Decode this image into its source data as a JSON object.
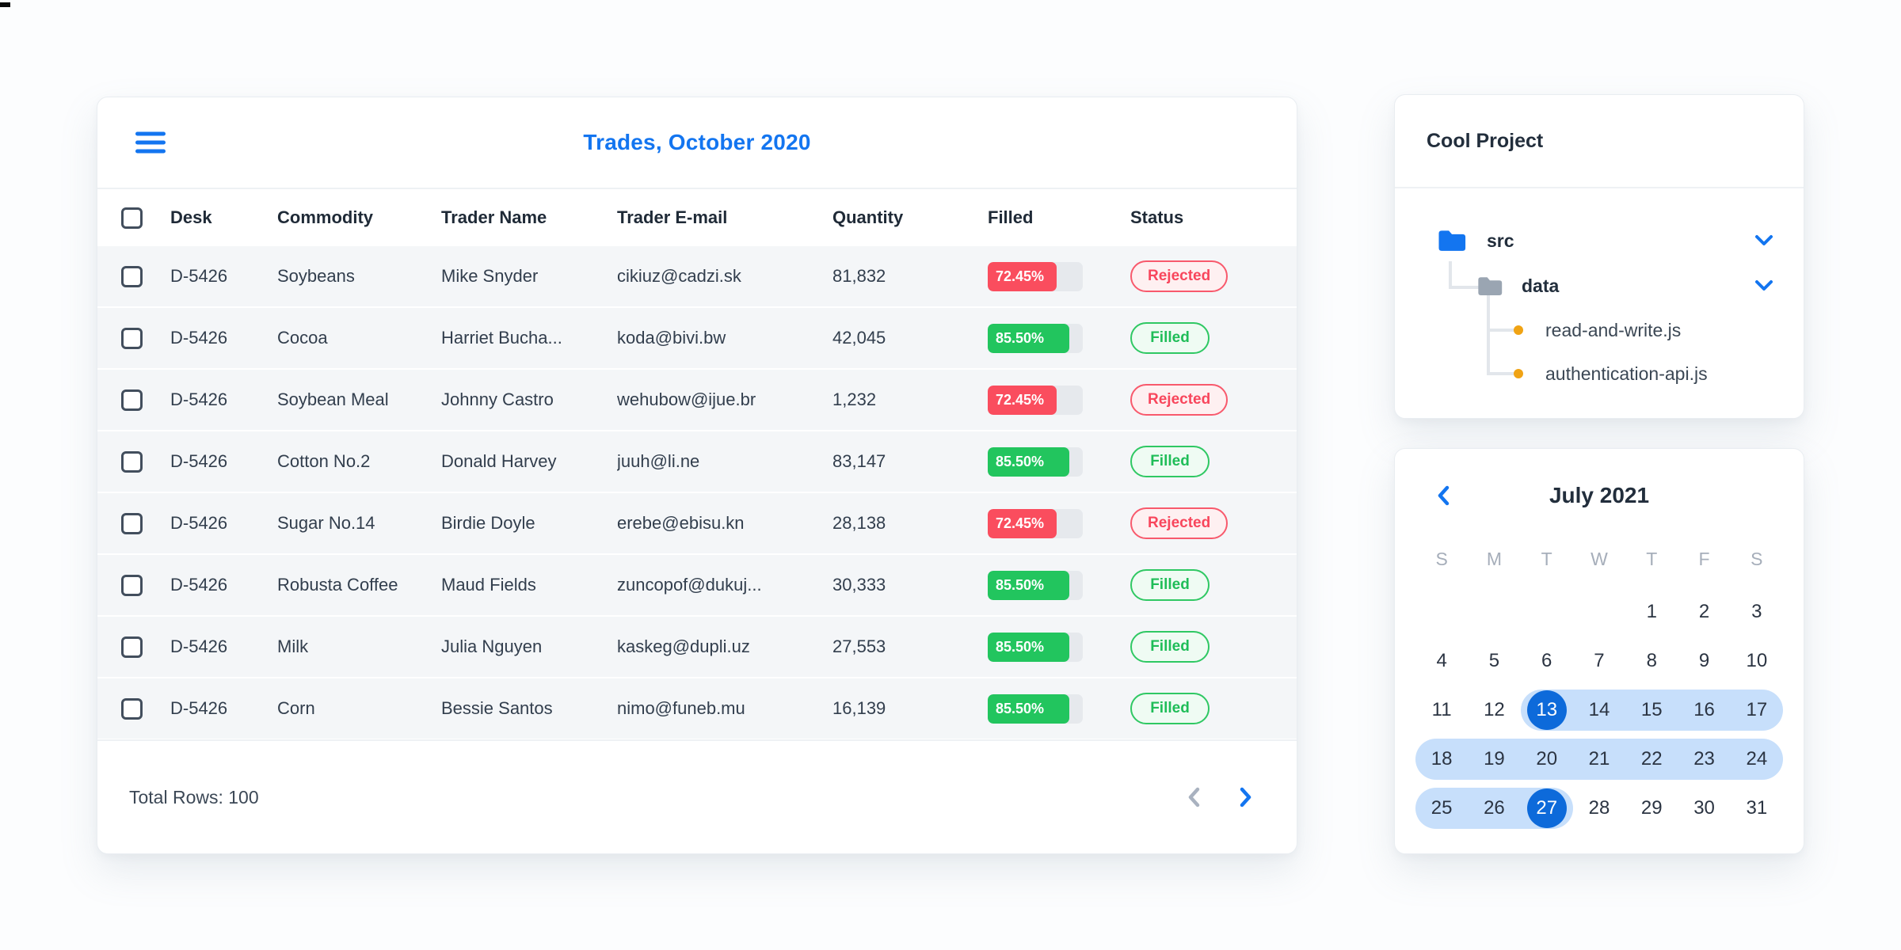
{
  "colors": {
    "accent_blue": "#1375f0",
    "calendar_selected_blue": "#0d6ada",
    "range_blue": "#c7dffb",
    "bar_red": "#fa4d5e",
    "bar_green": "#22c55e",
    "status_rejected_red": "#f8465c",
    "status_filled_green": "#1fbd58",
    "row_background": "#f4f6f8",
    "orange_dot": "#f0a314"
  },
  "trades": {
    "title": "Trades, October 2020",
    "menu_icon": "hamburger-menu",
    "columns": [
      "Desk",
      "Commodity",
      "Trader Name",
      "Trader E-mail",
      "Quantity",
      "Filled",
      "Status"
    ],
    "rows": [
      {
        "desk": "D-5426",
        "commodity": "Soybeans",
        "trader": "Mike Snyder",
        "email": "cikiuz@cadzi.sk",
        "quantity": "81,832",
        "filled_label": "72.45%",
        "filled_value": 72.45,
        "filled_color": "red",
        "status": "Rejected",
        "status_kind": "rejected"
      },
      {
        "desk": "D-5426",
        "commodity": "Cocoa",
        "trader": "Harriet Bucha...",
        "email": "koda@bivi.bw",
        "quantity": "42,045",
        "filled_label": "85.50%",
        "filled_value": 85.5,
        "filled_color": "green",
        "status": "Filled",
        "status_kind": "filled"
      },
      {
        "desk": "D-5426",
        "commodity": "Soybean Meal",
        "trader": "Johnny Castro",
        "email": "wehubow@ijue.br",
        "quantity": "1,232",
        "filled_label": "72.45%",
        "filled_value": 72.45,
        "filled_color": "red",
        "status": "Rejected",
        "status_kind": "rejected"
      },
      {
        "desk": "D-5426",
        "commodity": "Cotton No.2",
        "trader": "Donald Harvey",
        "email": "juuh@li.ne",
        "quantity": "83,147",
        "filled_label": "85.50%",
        "filled_value": 85.5,
        "filled_color": "green",
        "status": "Filled",
        "status_kind": "filled"
      },
      {
        "desk": "D-5426",
        "commodity": "Sugar No.14",
        "trader": "Birdie Doyle",
        "email": "erebe@ebisu.kn",
        "quantity": "28,138",
        "filled_label": "72.45%",
        "filled_value": 72.45,
        "filled_color": "red",
        "status": "Rejected",
        "status_kind": "rejected"
      },
      {
        "desk": "D-5426",
        "commodity": "Robusta Coffee",
        "trader": "Maud Fields",
        "email": "zuncopof@dukuj...",
        "quantity": "30,333",
        "filled_label": "85.50%",
        "filled_value": 85.5,
        "filled_color": "green",
        "status": "Filled",
        "status_kind": "filled"
      },
      {
        "desk": "D-5426",
        "commodity": "Milk",
        "trader": "Julia Nguyen",
        "email": "kaskeg@dupli.uz",
        "quantity": "27,553",
        "filled_label": "85.50%",
        "filled_value": 85.5,
        "filled_color": "green",
        "status": "Filled",
        "status_kind": "filled"
      },
      {
        "desk": "D-5426",
        "commodity": "Corn",
        "trader": "Bessie Santos",
        "email": "nimo@funeb.mu",
        "quantity": "16,139",
        "filled_label": "85.50%",
        "filled_value": 85.5,
        "filled_color": "green",
        "status": "Filled",
        "status_kind": "filled"
      }
    ],
    "footer": {
      "total_rows": "Total Rows: 100",
      "prev_icon": "chevron-left",
      "next_icon": "chevron-right"
    }
  },
  "project": {
    "title": "Cool Project",
    "tree": {
      "src_label": "src",
      "data_label": "data",
      "file1_label": "read-and-write.js",
      "file2_label": "authentication-api.js"
    }
  },
  "calendar": {
    "title": "July 2021",
    "prev_icon": "chevron-left",
    "weekdays": [
      "S",
      "M",
      "T",
      "W",
      "T",
      "F",
      "S"
    ],
    "weeks": [
      [
        "",
        "",
        "",
        "",
        "1",
        "2",
        "3"
      ],
      [
        "4",
        "5",
        "6",
        "7",
        "8",
        "9",
        "10"
      ],
      [
        "11",
        "12",
        "13",
        "14",
        "15",
        "16",
        "17"
      ],
      [
        "18",
        "19",
        "20",
        "21",
        "22",
        "23",
        "24"
      ],
      [
        "25",
        "26",
        "27",
        "28",
        "29",
        "30",
        "31"
      ]
    ],
    "range_start": 13,
    "range_end": 27,
    "selected_days": [
      13,
      27
    ]
  }
}
